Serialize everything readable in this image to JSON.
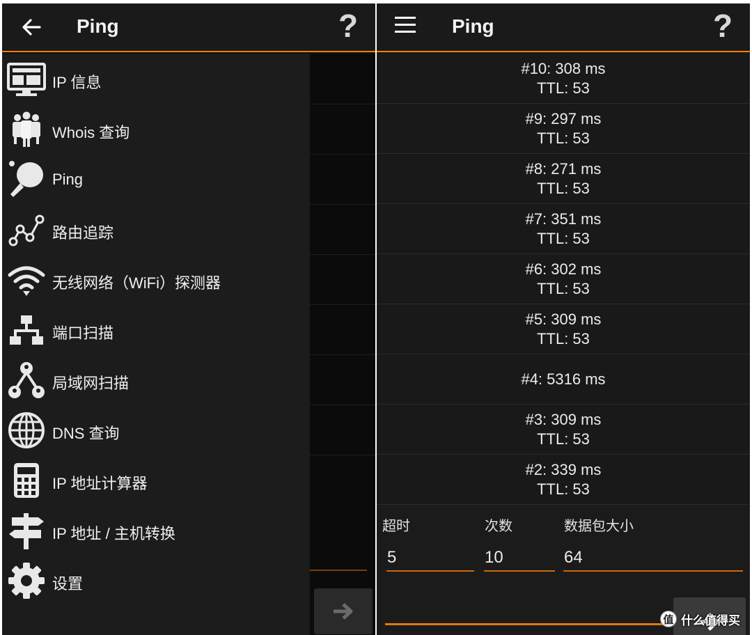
{
  "left_panel": {
    "title": "Ping",
    "help_glyph": "?",
    "back_icon": "arrow-left-icon",
    "drawer_items": [
      {
        "label": "IP 信息",
        "icon": "monitor-icon"
      },
      {
        "label": "Whois 查询",
        "icon": "people-icon"
      },
      {
        "label": "Ping",
        "icon": "ping-pong-icon"
      },
      {
        "label": "路由追踪",
        "icon": "route-icon"
      },
      {
        "label": "无线网络（WiFi）探测器",
        "icon": "wifi-icon"
      },
      {
        "label": "端口扫描",
        "icon": "port-scan-icon"
      },
      {
        "label": "局域网扫描",
        "icon": "lan-icon"
      },
      {
        "label": "DNS 查询",
        "icon": "globe-icon"
      },
      {
        "label": "IP 地址计算器",
        "icon": "calculator-icon"
      },
      {
        "label": "IP 地址 / 主机转换",
        "icon": "signpost-icon"
      },
      {
        "label": "设置",
        "icon": "gear-icon"
      }
    ]
  },
  "right_panel": {
    "title": "Ping",
    "help_glyph": "?",
    "menu_icon": "hamburger-menu-icon",
    "results": [
      {
        "line1": "#10: 308 ms",
        "line2": "TTL: 53"
      },
      {
        "line1": "#9: 297 ms",
        "line2": "TTL: 53"
      },
      {
        "line1": "#8: 271 ms",
        "line2": "TTL: 53"
      },
      {
        "line1": "#7: 351 ms",
        "line2": "TTL: 53"
      },
      {
        "line1": "#6: 302 ms",
        "line2": "TTL: 53"
      },
      {
        "line1": "#5: 309 ms",
        "line2": "TTL: 53"
      },
      {
        "line1": "#4: 5316 ms",
        "line2": ""
      },
      {
        "line1": "#3: 309 ms",
        "line2": "TTL: 53"
      },
      {
        "line1": "#2: 339 ms",
        "line2": "TTL: 53"
      }
    ],
    "form": {
      "timeout_label": "超时",
      "timeout_value": "5",
      "count_label": "次数",
      "count_value": "10",
      "size_label": "数据包大小",
      "size_value": "64",
      "host_value": ""
    }
  },
  "watermark": {
    "badge": "值",
    "text": "什么值得买"
  },
  "colors": {
    "accent": "#f0820a",
    "background": "#191919",
    "drawer": "#1c1c1c"
  }
}
